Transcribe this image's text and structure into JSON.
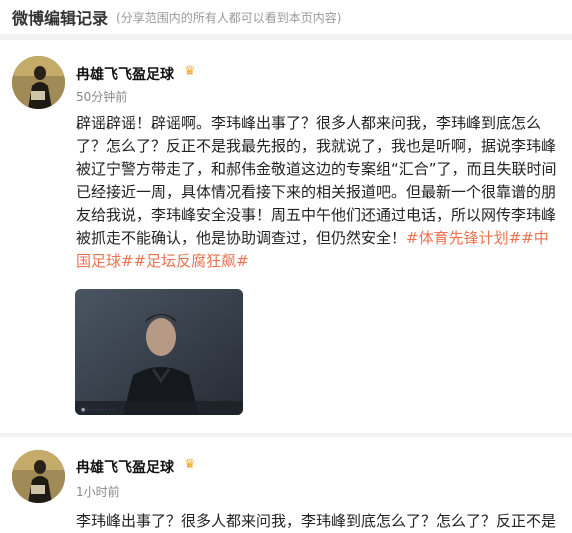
{
  "header": {
    "title": "微博编辑记录",
    "subtitle": "(分享范围内的所有人都可以看到本页内容)"
  },
  "posts": [
    {
      "username": "冉雄飞飞盈足球",
      "time": "50分钟前",
      "text": "辟谣辟谣！辟谣啊。李玮峰出事了？很多人都来问我，李玮峰到底怎么了？怎么了？反正不是我最先报的，我就说了，我也是听啊，据说李玮峰被辽宁警方带走了，和郝伟金敬道这边的专案组“汇合”了，而且失联时间已经接近一周，具体情况看接下来的相关报道吧。但最新一个很靠谱的朋友给我说，李玮峰安全没事！周五中午他们还通过电话，所以网传李玮峰被抓走不能确认，他是协助调查过，但仍然安全！",
      "topics": "#体育先锋计划##中国足球##足坛反腐狂飙#",
      "image": "photo-of-man"
    },
    {
      "username": "冉雄飞飞盈足球",
      "time": "1小时前",
      "text": "李玮峰出事了？很多人都来问我，李玮峰到底怎么了？怎么了？反正不是"
    }
  ],
  "colors": {
    "topic": "#eb7350",
    "crown": "#f5a623",
    "background": "#f2f2f2"
  }
}
